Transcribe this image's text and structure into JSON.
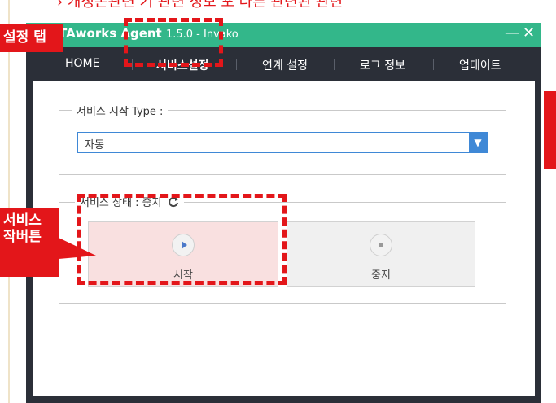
{
  "annotation_top": "› 개정본관련 기 관련 정보 포 다른 관련된 관련",
  "window": {
    "title_brand": "TAworks",
    "title_rest": " Agent",
    "version": "1.5.0 - Invako",
    "minimize_glyph": "—",
    "close_glyph": "✕"
  },
  "tabs": [
    {
      "label": "HOME"
    },
    {
      "label": "서비스설정"
    },
    {
      "label": "연계 설정"
    },
    {
      "label": "로그 정보"
    },
    {
      "label": "업데이트"
    }
  ],
  "service_type": {
    "legend": "서비스 시작 Type :",
    "selected": "자동"
  },
  "service_state": {
    "legend": "서비스 상태 : 중지",
    "refresh_icon": "refresh-icon"
  },
  "buttons": {
    "start_label": "시작",
    "stop_label": "중지"
  },
  "callouts": {
    "tab_callout": "설정 탭",
    "service_callout_line1": "서비스",
    "service_callout_line2": "작버튼"
  },
  "colors": {
    "accent_green": "#33b78a",
    "annotation_red": "#e3161a",
    "select_blue": "#3f88d6",
    "window_dark": "#2b2f38"
  }
}
